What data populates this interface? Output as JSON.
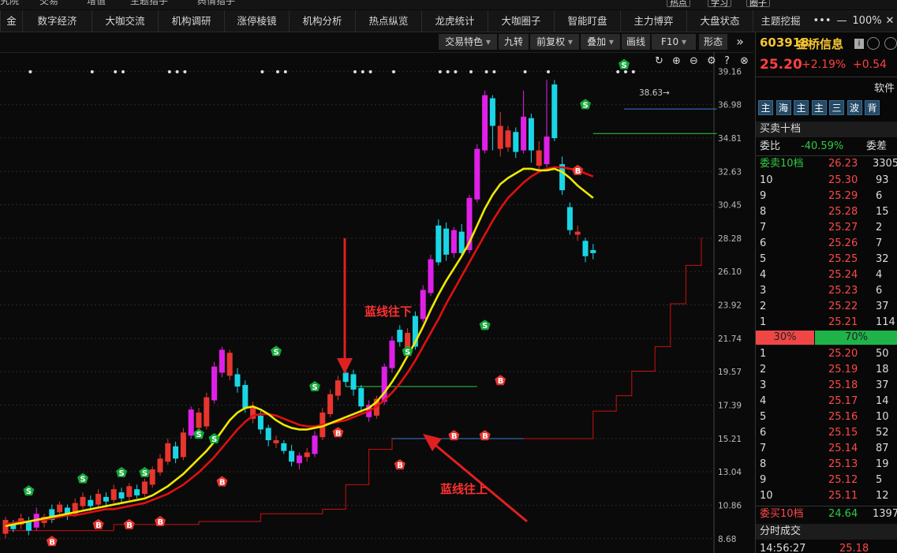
{
  "top_strip": {
    "items": [
      "究院",
      "交易",
      "增值",
      "主题猎手",
      "舆情猎手"
    ],
    "buttons": [
      "热点",
      "学习",
      "圈子"
    ]
  },
  "tabs": [
    "金",
    "数字经济",
    "大咖交流",
    "机构调研",
    "涨停棱镜",
    "机构分析",
    "热点纵览",
    "龙虎统计",
    "大咖圈子",
    "智能盯盘",
    "主力博弈",
    "大盘状态",
    "主题挖掘"
  ],
  "window": {
    "more": "•••",
    "minimize": "—",
    "zoom": "100%",
    "close": "✕"
  },
  "toolbar": {
    "items": [
      {
        "label": "交易特色",
        "dropdown": true
      },
      {
        "label": "九转",
        "dropdown": false
      },
      {
        "label": "前复权",
        "dropdown": true
      },
      {
        "label": "叠加",
        "dropdown": true
      },
      {
        "label": "画线",
        "dropdown": false
      },
      {
        "label": "F10",
        "dropdown": true
      },
      {
        "label": "形态",
        "dropdown": false
      }
    ],
    "expand": "»"
  },
  "chart_icons": [
    "↻",
    "⊕",
    "⊖",
    "⚙",
    "?",
    "⊗"
  ],
  "chart_data": {
    "type": "candlestick",
    "y_ticks": [
      39.16,
      36.98,
      34.81,
      32.63,
      30.45,
      28.28,
      26.1,
      23.92,
      21.74,
      19.57,
      17.39,
      15.21,
      13.04,
      10.86,
      8.68
    ],
    "ylim": [
      8.0,
      40.0
    ],
    "high_label": "38.63",
    "candles": [
      [
        9.0,
        9.9,
        8.7,
        10.1
      ],
      [
        9.3,
        9.7,
        9.1,
        9.9
      ],
      [
        9.6,
        10.0,
        9.3,
        10.3
      ],
      [
        9.8,
        9.2,
        8.9,
        10.1
      ],
      [
        9.4,
        10.3,
        9.2,
        10.7
      ],
      [
        10.1,
        9.7,
        9.4,
        10.3
      ],
      [
        9.9,
        10.6,
        9.7,
        10.9
      ],
      [
        10.4,
        10.9,
        10.1,
        11.1
      ],
      [
        10.7,
        10.2,
        9.9,
        10.9
      ],
      [
        10.3,
        11.0,
        10.1,
        11.3
      ],
      [
        10.8,
        11.4,
        10.6,
        11.7
      ],
      [
        11.2,
        10.8,
        10.5,
        11.5
      ],
      [
        10.9,
        11.6,
        10.7,
        11.9
      ],
      [
        11.4,
        11.1,
        10.8,
        11.7
      ],
      [
        11.2,
        11.9,
        11.0,
        12.2
      ],
      [
        11.7,
        11.3,
        11.0,
        12.0
      ],
      [
        11.4,
        12.1,
        11.2,
        12.3
      ],
      [
        11.9,
        11.5,
        11.3,
        12.2
      ],
      [
        11.6,
        12.4,
        11.4,
        12.6
      ],
      [
        12.2,
        13.2,
        12.0,
        13.4
      ],
      [
        13.0,
        13.9,
        12.8,
        14.2
      ],
      [
        13.7,
        14.9,
        13.5,
        15.2
      ],
      [
        14.7,
        13.9,
        13.6,
        15.0
      ],
      [
        14.0,
        15.6,
        13.8,
        15.9
      ],
      [
        15.4,
        17.1,
        15.2,
        17.3
      ],
      [
        16.9,
        15.9,
        15.6,
        17.2
      ],
      [
        16.0,
        17.9,
        15.8,
        18.2
      ],
      [
        17.7,
        19.9,
        17.5,
        20.2
      ],
      [
        19.5,
        21.0,
        19.2,
        21.2
      ],
      [
        20.8,
        19.3,
        19.0,
        21.0
      ],
      [
        19.4,
        18.6,
        18.2,
        19.8
      ],
      [
        18.7,
        17.2,
        16.9,
        19.0
      ],
      [
        17.3,
        16.5,
        16.2,
        17.6
      ],
      [
        16.7,
        15.8,
        15.5,
        17.0
      ],
      [
        15.9,
        15.1,
        14.7,
        16.1
      ],
      [
        15.1,
        14.9,
        14.6,
        15.4
      ],
      [
        14.9,
        14.4,
        14.2,
        15.1
      ],
      [
        14.4,
        13.7,
        13.4,
        14.8
      ],
      [
        13.6,
        14.1,
        13.2,
        14.3
      ],
      [
        14.0,
        14.3,
        13.7,
        14.6
      ],
      [
        14.2,
        15.4,
        14.0,
        15.7
      ],
      [
        15.3,
        16.9,
        15.1,
        17.2
      ],
      [
        16.8,
        18.1,
        16.6,
        18.4
      ],
      [
        18.0,
        19.0,
        17.7,
        19.3
      ],
      [
        18.9,
        19.5,
        18.6,
        19.8
      ],
      [
        19.4,
        18.4,
        18.0,
        19.7
      ],
      [
        18.5,
        17.3,
        16.9,
        18.7
      ],
      [
        17.4,
        16.6,
        16.3,
        17.7
      ],
      [
        16.7,
        17.8,
        16.5,
        18.0
      ],
      [
        17.6,
        19.9,
        17.4,
        20.1
      ],
      [
        19.8,
        21.6,
        19.5,
        21.9
      ],
      [
        21.5,
        22.3,
        21.2,
        22.6
      ],
      [
        22.1,
        21.1,
        20.8,
        22.4
      ],
      [
        21.2,
        23.2,
        21.0,
        23.5
      ],
      [
        23.0,
        24.9,
        22.8,
        25.2
      ],
      [
        24.7,
        26.9,
        24.5,
        27.2
      ],
      [
        26.7,
        29.1,
        26.5,
        29.5
      ],
      [
        28.9,
        27.2,
        26.8,
        29.3
      ],
      [
        27.3,
        28.8,
        27.0,
        29.0
      ],
      [
        28.7,
        27.3,
        27.0,
        29.2
      ],
      [
        27.5,
        30.9,
        27.3,
        31.1
      ],
      [
        30.8,
        34.1,
        30.6,
        34.4
      ],
      [
        34.0,
        37.6,
        33.8,
        37.9
      ],
      [
        37.4,
        35.6,
        34.0,
        37.6
      ],
      [
        35.6,
        34.1,
        33.6,
        36.5
      ],
      [
        34.2,
        35.3,
        33.9,
        35.6
      ],
      [
        35.2,
        33.9,
        33.5,
        35.5
      ],
      [
        34.0,
        36.2,
        33.8,
        37.9
      ],
      [
        36.1,
        34.0,
        33.2,
        36.4
      ],
      [
        34.0,
        33.0,
        32.6,
        34.6
      ],
      [
        33.1,
        34.9,
        32.9,
        38.6
      ],
      [
        34.8,
        38.3,
        34.6,
        38.6
      ],
      [
        33.1,
        31.4,
        31.1,
        33.6
      ],
      [
        30.3,
        28.8,
        28.5,
        30.6
      ],
      [
        28.7,
        28.5,
        28.1,
        29.1
      ],
      [
        28.1,
        27.1,
        26.7,
        28.3
      ],
      [
        27.3,
        27.5,
        26.9,
        27.9
      ]
    ],
    "colors": [
      "red",
      "cyan",
      "red",
      "cyan",
      "magenta",
      "red",
      "cyan",
      "red",
      "cyan",
      "red",
      "red",
      "cyan",
      "red",
      "cyan",
      "red",
      "cyan",
      "red",
      "cyan",
      "red",
      "red",
      "red",
      "red",
      "cyan",
      "red",
      "magenta",
      "red",
      "red",
      "magenta",
      "magenta",
      "red",
      "cyan",
      "cyan",
      "red",
      "cyan",
      "cyan",
      "red",
      "cyan",
      "cyan",
      "magenta",
      "red",
      "magenta",
      "red",
      "red",
      "red",
      "cyan",
      "cyan",
      "cyan",
      "magenta",
      "red",
      "magenta",
      "magenta",
      "cyan",
      "red",
      "cyan",
      "magenta",
      "magenta",
      "cyan",
      "cyan",
      "magenta",
      "cyan",
      "magenta",
      "magenta",
      "magenta",
      "cyan",
      "red",
      "red",
      "cyan",
      "magenta",
      "cyan",
      "red",
      "magenta",
      "cyan",
      "cyan",
      "cyan",
      "red",
      "cyan",
      "cyan"
    ],
    "ma_short_yellow": [
      9.5,
      9.6,
      9.7,
      9.8,
      9.9,
      10.0,
      10.1,
      10.2,
      10.3,
      10.4,
      10.5,
      10.6,
      10.7,
      10.8,
      10.9,
      11.0,
      11.1,
      11.2,
      11.3,
      11.5,
      11.8,
      12.1,
      12.5,
      12.9,
      13.4,
      13.9,
      14.4,
      15.0,
      15.7,
      16.4,
      16.9,
      17.2,
      17.3,
      17.1,
      16.8,
      16.4,
      16.1,
      15.9,
      15.8,
      15.8,
      15.9,
      16.0,
      16.2,
      16.4,
      16.6,
      16.8,
      17.0,
      17.2,
      17.6,
      18.2,
      18.9,
      19.7,
      20.6,
      21.5,
      22.5,
      23.6,
      24.6,
      25.5,
      26.3,
      27.1,
      28.0,
      29.1,
      30.2,
      31.1,
      31.8,
      32.2,
      32.5,
      32.8,
      32.8,
      32.7,
      32.7,
      32.8,
      32.6,
      32.2,
      31.7,
      31.3,
      30.9
    ],
    "ma_long_red": [
      9.6,
      9.7,
      9.8,
      9.8,
      9.9,
      9.9,
      10.0,
      10.1,
      10.2,
      10.2,
      10.3,
      10.4,
      10.5,
      10.6,
      10.6,
      10.7,
      10.8,
      10.9,
      11.0,
      11.2,
      11.4,
      11.6,
      11.9,
      12.2,
      12.6,
      13.0,
      13.5,
      14.0,
      14.6,
      15.2,
      15.8,
      16.3,
      16.7,
      16.8,
      16.8,
      16.7,
      16.5,
      16.3,
      16.1,
      16.0,
      16.0,
      16.1,
      16.2,
      16.3,
      16.4,
      16.6,
      16.8,
      17.0,
      17.3,
      17.7,
      18.2,
      18.8,
      19.5,
      20.3,
      21.2,
      22.1,
      23.0,
      24.0,
      24.9,
      25.8,
      26.7,
      27.6,
      28.5,
      29.4,
      30.2,
      30.9,
      31.4,
      31.9,
      32.3,
      32.6,
      32.8,
      32.9,
      32.9,
      32.8,
      32.7,
      32.5,
      32.3
    ],
    "s_markers": [
      {
        "i": 3,
        "v": 11.8
      },
      {
        "i": 10,
        "v": 12.6
      },
      {
        "i": 15,
        "v": 13.0
      },
      {
        "i": 18,
        "v": 13.0
      },
      {
        "i": 25,
        "v": 15.5
      },
      {
        "i": 27,
        "v": 15.2
      },
      {
        "i": 35,
        "v": 20.9
      },
      {
        "i": 40,
        "v": 18.6
      },
      {
        "i": 52,
        "v": 20.9
      },
      {
        "i": 62,
        "v": 22.6
      },
      {
        "i": 75,
        "v": 37.0
      },
      {
        "i": 80,
        "v": 39.6
      }
    ],
    "b_markers": [
      {
        "i": 6,
        "v": 8.5
      },
      {
        "i": 12,
        "v": 9.6
      },
      {
        "i": 16,
        "v": 9.6
      },
      {
        "i": 20,
        "v": 9.8
      },
      {
        "i": 28,
        "v": 12.4
      },
      {
        "i": 43,
        "v": 15.6
      },
      {
        "i": 51,
        "v": 13.5
      },
      {
        "i": 58,
        "v": 15.4
      },
      {
        "i": 62,
        "v": 15.4
      },
      {
        "i": 64,
        "v": 19.0
      },
      {
        "i": 74,
        "v": 32.7
      }
    ],
    "dot_rows": [
      {
        "i": 3
      },
      {
        "i": 11
      },
      {
        "i": 14
      },
      {
        "i": 15
      },
      {
        "i": 21
      },
      {
        "i": 22
      },
      {
        "i": 23
      },
      {
        "i": 33
      },
      {
        "i": 35
      },
      {
        "i": 36
      },
      {
        "i": 45
      },
      {
        "i": 46
      },
      {
        "i": 47
      },
      {
        "i": 50
      },
      {
        "i": 56
      },
      {
        "i": 57
      },
      {
        "i": 58
      },
      {
        "i": 60
      },
      {
        "i": 62
      },
      {
        "i": 63
      },
      {
        "i": 67
      },
      {
        "i": 70
      },
      {
        "i": 79
      },
      {
        "i": 80
      },
      {
        "i": 81
      }
    ]
  },
  "annotations": {
    "down": "蓝线往下",
    "up": "蓝线往上"
  },
  "quote": {
    "code": "603918",
    "name": "金桥信息",
    "price": "25.20",
    "change_pct": "+2.19%",
    "change": "+0.54",
    "software_tag": "软件",
    "icon_buttons": [
      "主",
      "海",
      "主",
      "主",
      "三",
      "波",
      "背"
    ],
    "bidask_title": "买卖十档",
    "weibi_label": "委比",
    "weibi_value": "-40.59%",
    "weicha_label": "委差",
    "sell10_label": "委卖10档",
    "sell10_price": "26.23",
    "sell10_vol": "3305",
    "asks": [
      {
        "level": "10",
        "price": "25.30",
        "vol": "93"
      },
      {
        "level": "9",
        "price": "25.29",
        "vol": "6"
      },
      {
        "level": "8",
        "price": "25.28",
        "vol": "15"
      },
      {
        "level": "7",
        "price": "25.27",
        "vol": "2"
      },
      {
        "level": "6",
        "price": "25.26",
        "vol": "7"
      },
      {
        "level": "5",
        "price": "25.25",
        "vol": "32"
      },
      {
        "level": "4",
        "price": "25.24",
        "vol": "4"
      },
      {
        "level": "3",
        "price": "25.23",
        "vol": "6"
      },
      {
        "level": "2",
        "price": "25.22",
        "vol": "37"
      },
      {
        "level": "1",
        "price": "25.21",
        "vol": "114"
      }
    ],
    "ratio_left": "30%",
    "ratio_right": "70%",
    "bids": [
      {
        "level": "1",
        "price": "25.20",
        "vol": "50"
      },
      {
        "level": "2",
        "price": "25.19",
        "vol": "18"
      },
      {
        "level": "3",
        "price": "25.18",
        "vol": "37"
      },
      {
        "level": "4",
        "price": "25.17",
        "vol": "14"
      },
      {
        "level": "5",
        "price": "25.16",
        "vol": "10"
      },
      {
        "level": "6",
        "price": "25.15",
        "vol": "52"
      },
      {
        "level": "7",
        "price": "25.14",
        "vol": "87"
      },
      {
        "level": "8",
        "price": "25.13",
        "vol": "19"
      },
      {
        "level": "9",
        "price": "25.12",
        "vol": "5"
      },
      {
        "level": "10",
        "price": "25.11",
        "vol": "12"
      }
    ],
    "buy10_label": "委买10档",
    "buy10_price": "24.64",
    "buy10_vol": "1397",
    "trades_title": "分时成交",
    "trade_time": "14:56:27",
    "trade_price": "25.18"
  }
}
